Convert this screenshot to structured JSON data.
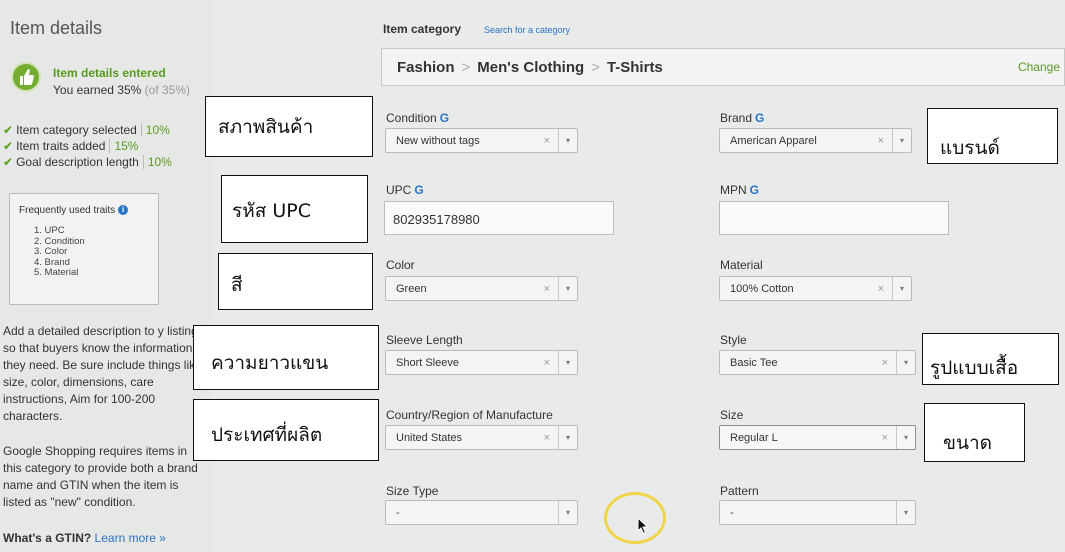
{
  "sidebar": {
    "title": "Item details",
    "status_title": "Item details entered",
    "earned_prefix": "You earned 35%",
    "earned_suffix": " (of 35%)",
    "checklist": [
      {
        "label": "Item category selected",
        "pct": "10%"
      },
      {
        "label": "Item traits added",
        "pct": "15%"
      },
      {
        "label": "Goal description length",
        "pct": "10%"
      }
    ],
    "traits_box": {
      "title": "Frequently used traits",
      "items": [
        "1. UPC",
        "2. Condition",
        "3. Color",
        "4. Brand",
        "5. Material"
      ]
    },
    "description": "Add a detailed description to y listing so that buyers know the information they need. Be sure include things like size, color, dimensions, care instructions, Aim for 100-200 characters.",
    "google_note": "Google Shopping requires items in this category to provide both a brand name and GTIN when the item is listed as \"new\" condition.",
    "gtin_question": "What's a GTIN?",
    "gtin_link": "Learn more »"
  },
  "category": {
    "label": "Item category",
    "search_link": "Search for a category",
    "breadcrumb": [
      "Fashion",
      "Men's Clothing",
      "T-Shirts"
    ],
    "change_label": "Change"
  },
  "fields": {
    "condition": {
      "label": "Condition",
      "value": "New without tags",
      "g": "G"
    },
    "brand": {
      "label": "Brand",
      "value": "American Apparel",
      "g": "G"
    },
    "upc": {
      "label": "UPC",
      "value": "802935178980",
      "g": "G"
    },
    "mpn": {
      "label": "MPN",
      "value": "",
      "g": "G"
    },
    "color": {
      "label": "Color",
      "value": "Green"
    },
    "material": {
      "label": "Material",
      "value": "100% Cotton"
    },
    "sleeve_length": {
      "label": "Sleeve Length",
      "value": "Short Sleeve"
    },
    "style": {
      "label": "Style",
      "value": "Basic Tee"
    },
    "country": {
      "label": "Country/Region of Manufacture",
      "value": "United States"
    },
    "size": {
      "label": "Size",
      "value": "Regular L"
    },
    "size_type": {
      "label": "Size Type",
      "value": "-"
    },
    "pattern": {
      "label": "Pattern",
      "value": "-"
    }
  },
  "overlay_labels": {
    "condition": "สภาพสินค้า",
    "upc": "รหัส UPC",
    "color": "สี",
    "sleeve": "ความยาวแขน",
    "country": "ประเทศที่ผลิต",
    "brand": "แบรนด์",
    "style": "รูปแบบเสื้อ",
    "size": "ขนาด"
  },
  "icons": {
    "clear": "×",
    "dropdown": "▾",
    "info": "i"
  },
  "colors": {
    "accent_green": "#5a9a22",
    "link_blue": "#2b73c5",
    "cursor_ring": "#f0d44a"
  }
}
